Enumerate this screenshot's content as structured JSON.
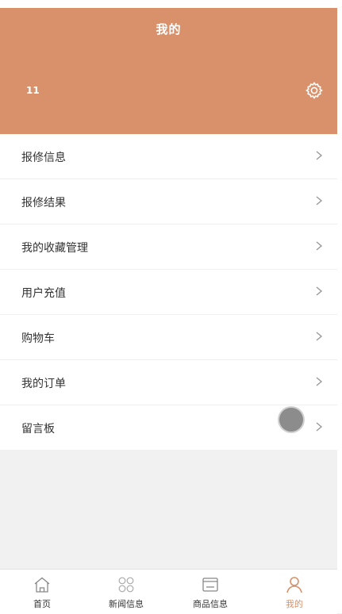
{
  "header": {
    "title": "我的",
    "username": "11",
    "settings_icon": "gear-icon",
    "background_color": "#d8916a"
  },
  "menu": {
    "items": [
      {
        "label": "报修信息"
      },
      {
        "label": "报修结果"
      },
      {
        "label": "我的收藏管理"
      },
      {
        "label": "用户充值"
      },
      {
        "label": "购物车"
      },
      {
        "label": "我的订单"
      },
      {
        "label": "留言板"
      }
    ]
  },
  "tabbar": {
    "active_color": "#d8916a",
    "tabs": [
      {
        "label": "首页",
        "icon": "home-icon"
      },
      {
        "label": "新闻信息",
        "icon": "grid-icon"
      },
      {
        "label": "商品信息",
        "icon": "window-icon"
      },
      {
        "label": "我的",
        "icon": "user-icon",
        "active": true
      }
    ]
  }
}
